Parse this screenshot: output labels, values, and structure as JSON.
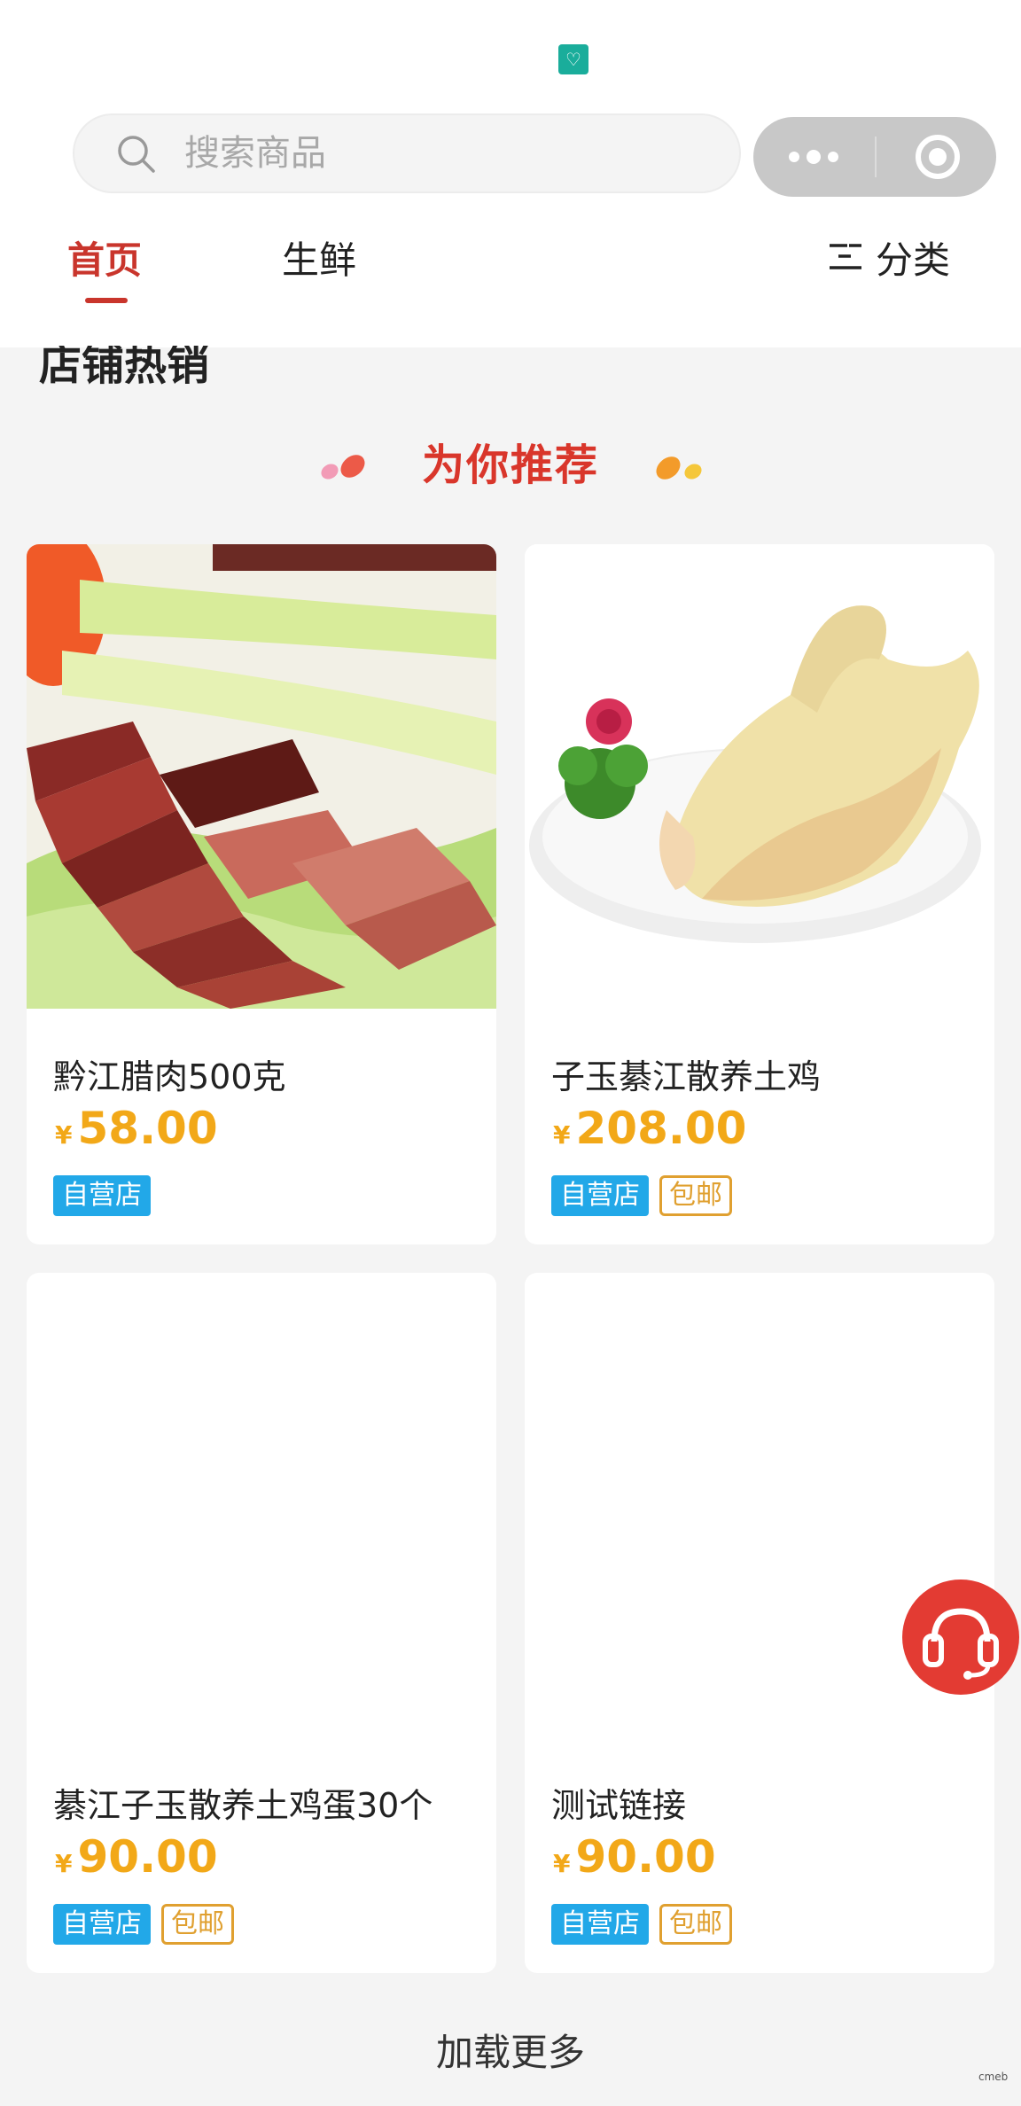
{
  "search": {
    "placeholder": "搜索商品"
  },
  "tabs": [
    {
      "label": "首页",
      "active": true
    },
    {
      "label": "生鲜",
      "active": false
    }
  ],
  "category_button": {
    "label": "分类"
  },
  "section_title": "店铺热销",
  "recommend_title": "为你推荐",
  "products": [
    {
      "name": "黔江腊肉500克",
      "currency": "¥",
      "price": "58.00",
      "tags": [
        "自营店"
      ]
    },
    {
      "name": "子玉綦江散养土鸡",
      "currency": "¥",
      "price": "208.00",
      "tags": [
        "自营店",
        "包邮"
      ]
    },
    {
      "name": "綦江子玉散养土鸡蛋30个",
      "currency": "¥",
      "price": "90.00",
      "tags": [
        "自营店",
        "包邮"
      ]
    },
    {
      "name": "测试链接",
      "currency": "¥",
      "price": "90.00",
      "tags": [
        "自营店",
        "包邮"
      ]
    }
  ],
  "load_more": "加载更多",
  "watermark": "cmeb",
  "colors": {
    "accent_red": "#c9352c",
    "price_orange": "#f2a818",
    "tag_blue": "#22a8e8",
    "tag_shipping": "#e0a030",
    "service_button": "#e33b33"
  },
  "icons": {
    "search": "search-icon",
    "more": "more-dots-icon",
    "close": "close-circle-icon",
    "category": "list-menu-icon",
    "service": "headset-icon",
    "app": "mini-program-icon"
  }
}
